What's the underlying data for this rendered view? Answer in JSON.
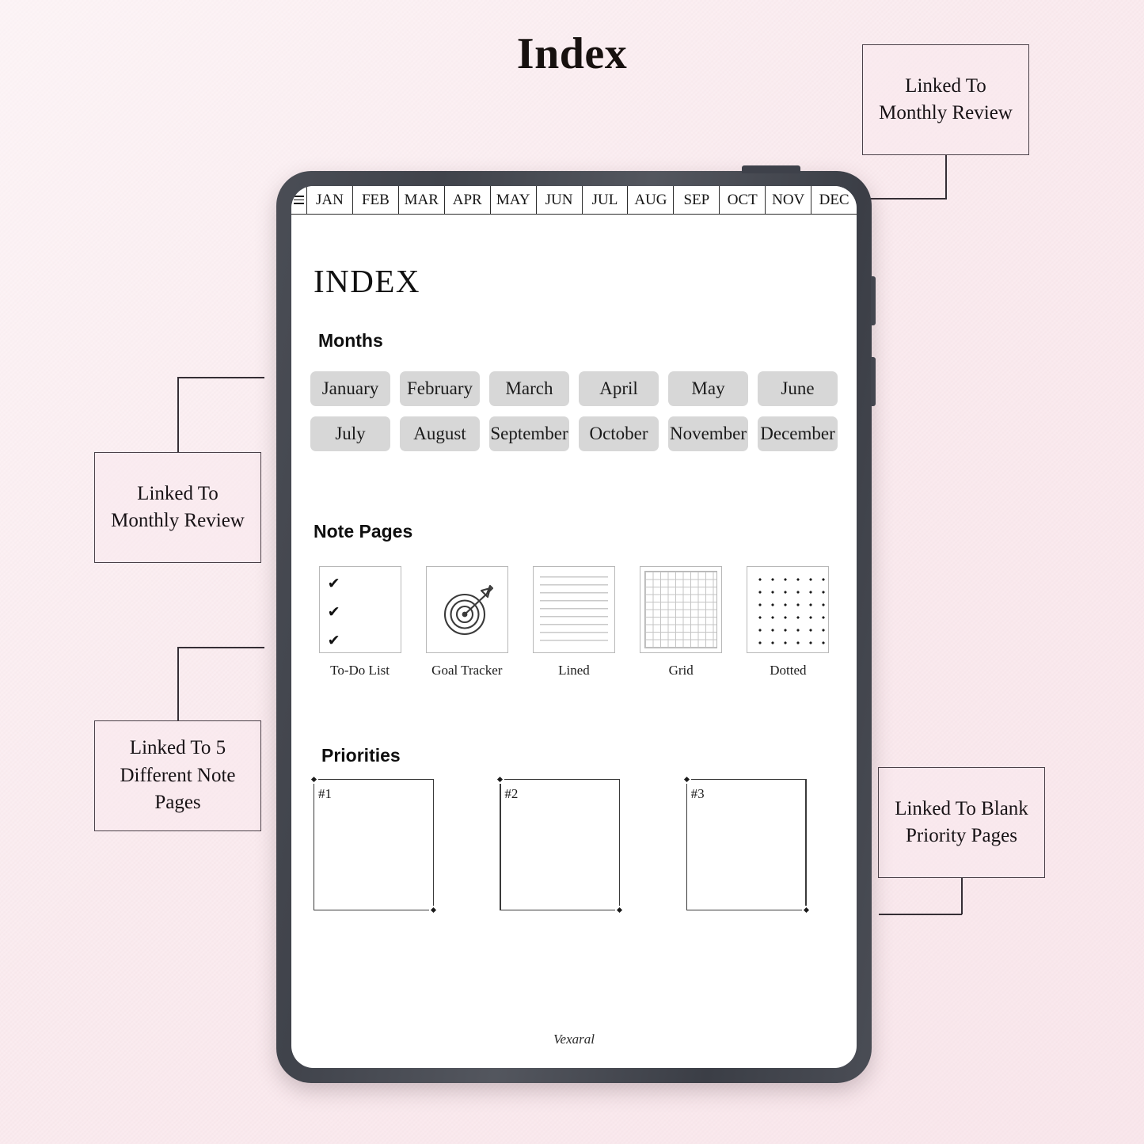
{
  "page": {
    "title": "Index",
    "background_color": "#faeaee"
  },
  "callouts": [
    {
      "id": "top-right",
      "text": "Linked To Monthly Review"
    },
    {
      "id": "left-upper",
      "text": "Linked To Monthly Review"
    },
    {
      "id": "left-lower",
      "text": "Linked To 5 Different Note Pages"
    },
    {
      "id": "bottom-right",
      "text": "Linked To Blank Priority Pages"
    }
  ],
  "tablet": {
    "menu_icon": "hamburger-icon",
    "month_tabs": [
      "JAN",
      "FEB",
      "MAR",
      "APR",
      "MAY",
      "JUN",
      "JUL",
      "AUG",
      "SEP",
      "OCT",
      "NOV",
      "DEC"
    ],
    "screen": {
      "heading": "INDEX",
      "sections": {
        "months": {
          "label": "Months",
          "buttons": [
            "January",
            "February",
            "March",
            "April",
            "May",
            "June",
            "July",
            "August",
            "September",
            "October",
            "November",
            "December"
          ]
        },
        "note_pages": {
          "label": "Note Pages",
          "items": [
            {
              "caption": "To-Do List",
              "icon": "checklist-icon"
            },
            {
              "caption": "Goal Tracker",
              "icon": "target-dart-icon"
            },
            {
              "caption": "Lined",
              "icon": "lined-paper-icon"
            },
            {
              "caption": "Grid",
              "icon": "grid-paper-icon"
            },
            {
              "caption": "Dotted",
              "icon": "dotted-paper-icon"
            }
          ]
        },
        "priorities": {
          "label": "Priorities",
          "boxes": [
            {
              "number": "#1"
            },
            {
              "number": "#2"
            },
            {
              "number": "#3"
            }
          ]
        }
      },
      "footer": "Vexaral"
    }
  }
}
